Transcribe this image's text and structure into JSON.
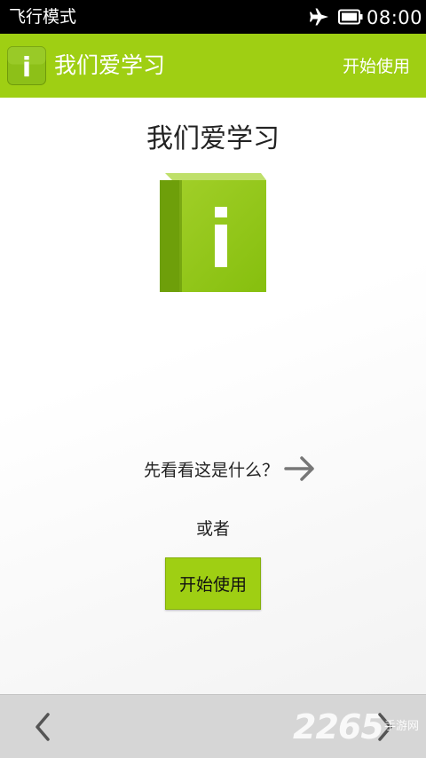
{
  "status_bar": {
    "mode": "飞行模式",
    "time": "08:00",
    "icons": [
      "airplane-icon",
      "battery-icon"
    ]
  },
  "action_bar": {
    "icon_letter": "i",
    "title": "我们爱学习",
    "start_label": "开始使用",
    "color": "#9fcf13"
  },
  "main": {
    "heading": "我们爱学习",
    "logo_letter": "i",
    "intro_text": "先看看这是什么？",
    "or_text": "或者",
    "start_button_label": "开始使用"
  },
  "bottom_nav": {
    "back_icon": "chevron-left-icon",
    "forward_icon": "chevron-right-icon",
    "watermark_number": "2265",
    "watermark_text": "手游网"
  },
  "colors": {
    "accent": "#9fcf13",
    "accent_dark": "#6f9a0a",
    "status_bar": "#000000",
    "bottom_bar": "#d6d6d6"
  }
}
